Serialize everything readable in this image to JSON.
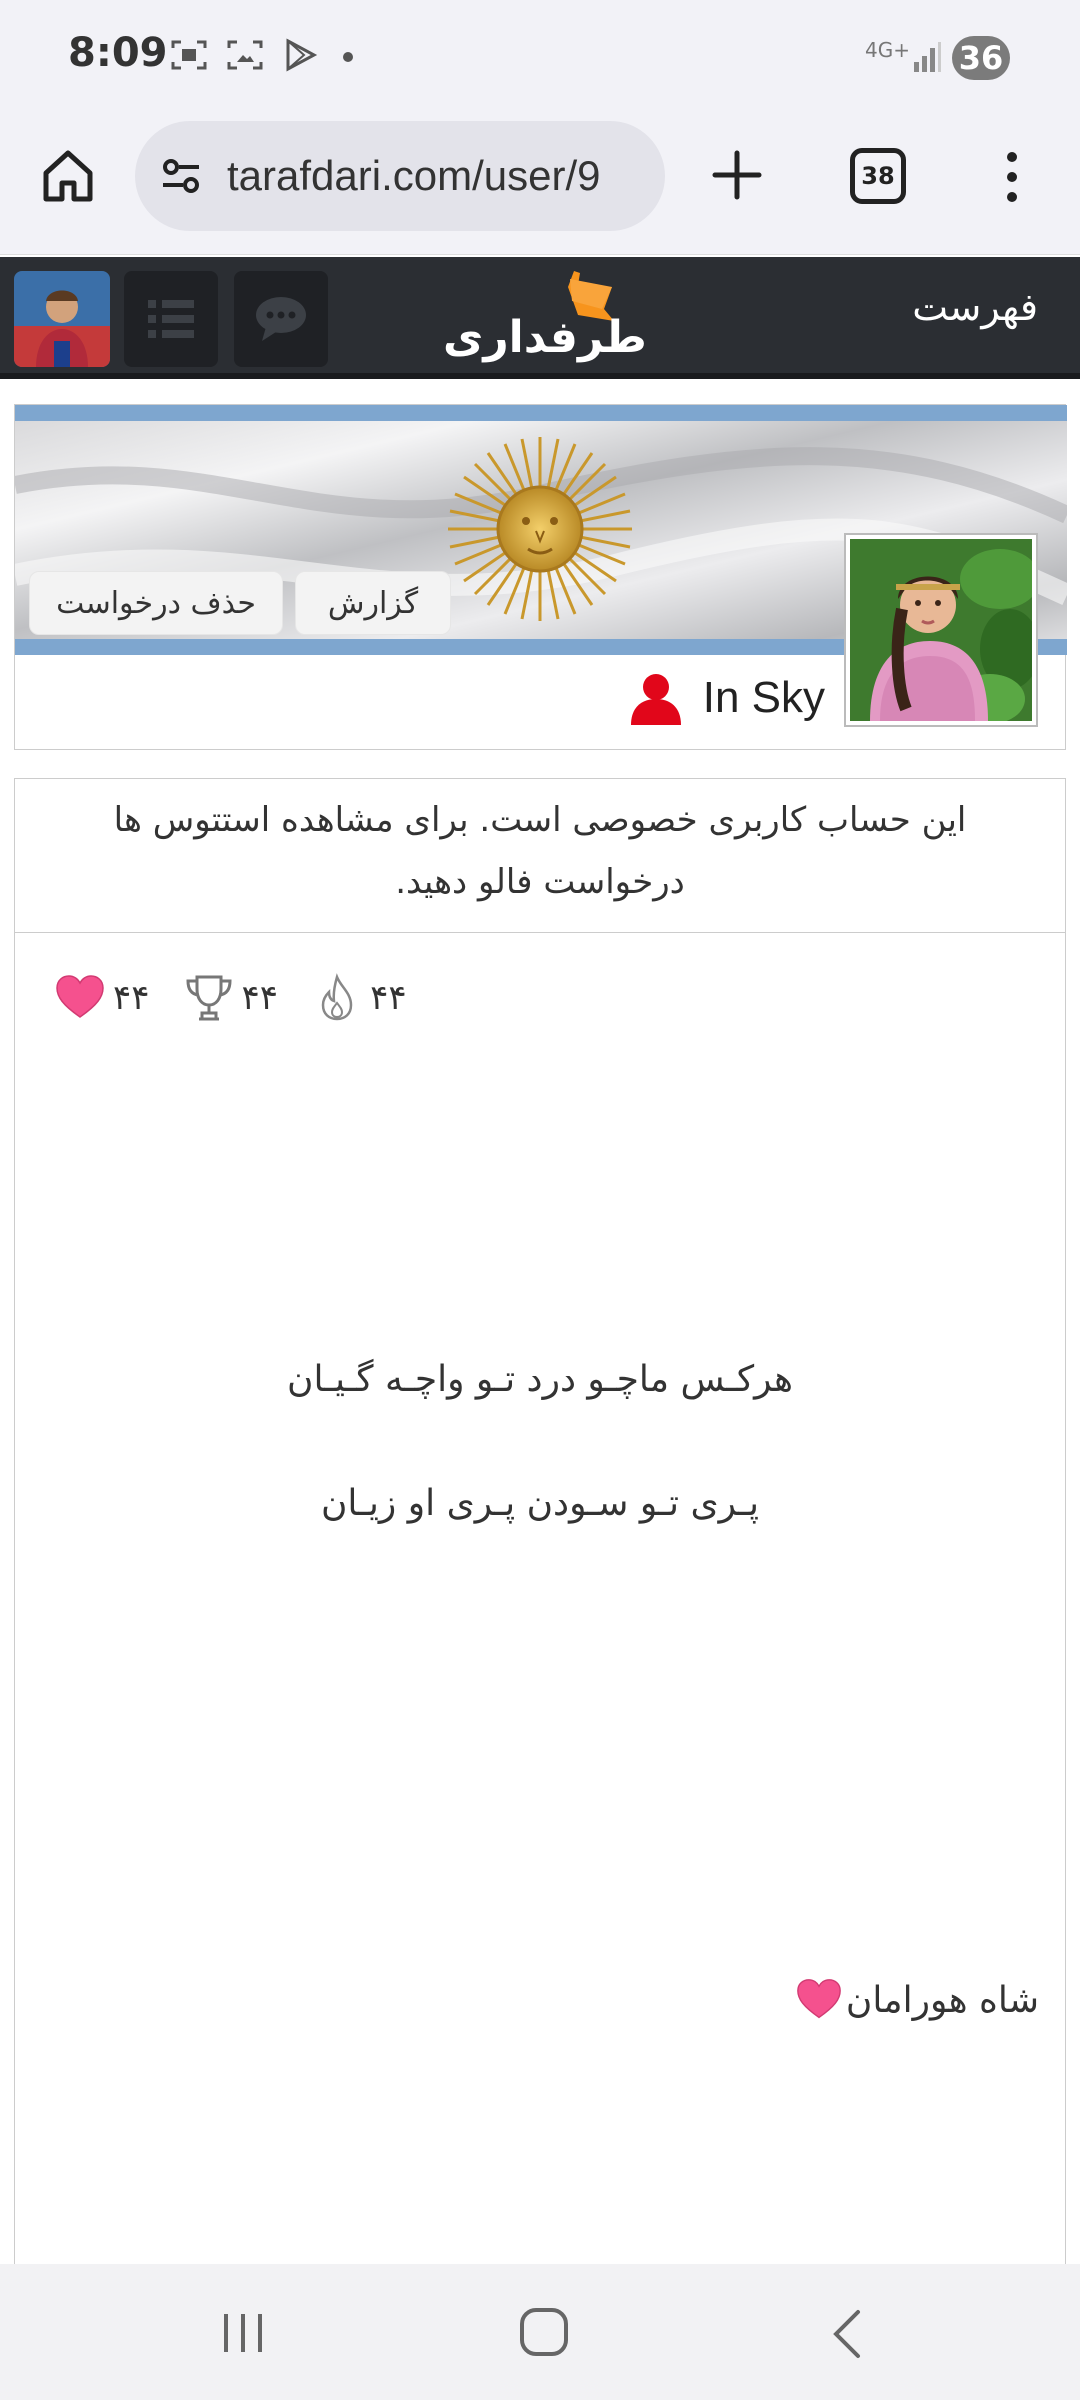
{
  "status_bar": {
    "time": "8:09",
    "network": "4G+",
    "battery": "36",
    "icons": [
      "screenshot-icon",
      "gallery-icon",
      "play-store-icon",
      "dot-icon"
    ]
  },
  "browser": {
    "url": "tarafdari.com/user/9",
    "tab_count": "38",
    "icons": [
      "home-icon",
      "site-settings-icon",
      "new-tab-icon",
      "more-menu-icon"
    ]
  },
  "site_header": {
    "logo_text": "طرفداری",
    "menu_label": "فهرست",
    "accent": "#f7941d",
    "background": "#2b2e33"
  },
  "profile": {
    "name": "In Sky",
    "report_button": "گزارش",
    "cancel_request_button": "حذف درخواست"
  },
  "content": {
    "private_message": "این حساب کاربری خصوصی است. برای مشاهده استتوس ها درخواست فالو دهید.",
    "stats": [
      {
        "icon": "flame-icon",
        "value": "۴۴"
      },
      {
        "icon": "trophy-icon",
        "value": "۴۴"
      },
      {
        "icon": "heart-icon",
        "value": "۴۴"
      }
    ],
    "poem_line1": "هرکـس ماچـو درد تـو واچـه گـیـان",
    "poem_line2": "پـری تـو سـودن پـری او زیـان",
    "signature": "شاه هورامان"
  },
  "navbar": {
    "icons": [
      "recent-apps-icon",
      "home-nav-icon",
      "back-icon"
    ]
  }
}
